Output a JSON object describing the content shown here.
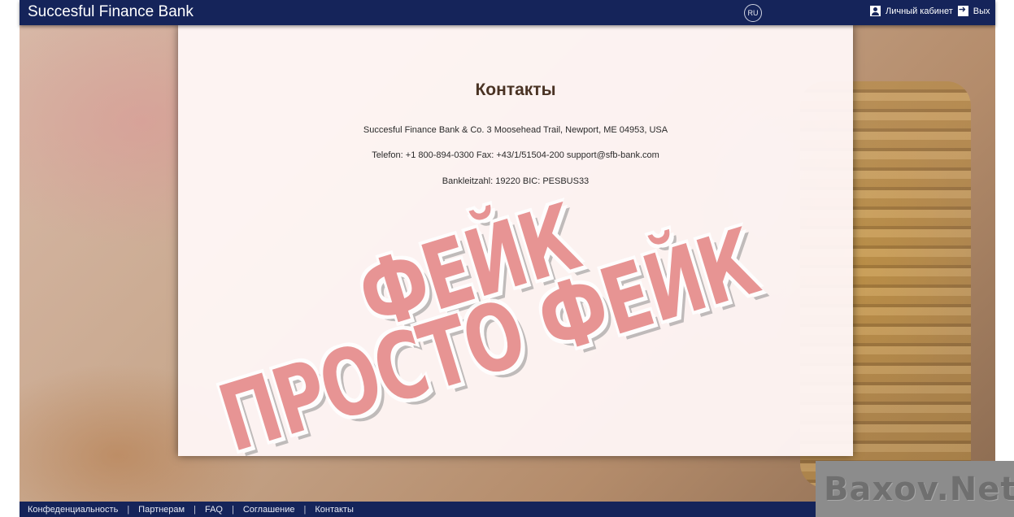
{
  "header": {
    "brand": "Succesful Finance Bank",
    "lang": "RU",
    "account_label": "Личный кабинет",
    "exit_label": "Вых"
  },
  "content": {
    "title": "Контакты",
    "address": "Succesful Finance Bank & Co. 3 Moosehead Trail, Newport, ME 04953, USA",
    "phone_line": "Telefon: +1 800-894-0300 Fax: +43/1/51504-200 support@sfb-bank.com",
    "bank_line": "Bankleitzahl: 19220 BIC: PESBUS33"
  },
  "stamp": {
    "line1": "ФЕЙК",
    "line2": "ПРОСТО ФЕЙК"
  },
  "footer": {
    "links": [
      "Конфеденциальность",
      "Партнерам",
      "FAQ",
      "Соглашение",
      "Контакты"
    ]
  },
  "watermark": "Baxov.Net",
  "colors": {
    "nav": "#15245a",
    "stamp": "#e58a8a"
  }
}
